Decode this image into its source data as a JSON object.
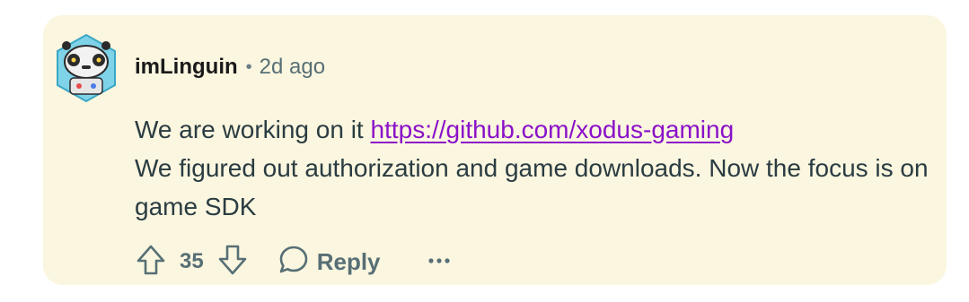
{
  "comment": {
    "author": "imLinguin",
    "separator": "•",
    "time_ago": "2d ago",
    "body": {
      "line1_text": "We are working on it ",
      "link_text": "https://github.com/xodus-gaming",
      "line2_text": "We figured out authorization and game downloads. Now the focus is on game SDK"
    },
    "actions": {
      "score": "35",
      "reply_label": "Reply",
      "more_label": "···"
    }
  },
  "colors": {
    "card_background": "#fbf6df",
    "link": "#8a12c9",
    "muted_text": "#576f76",
    "body_text": "#2a3c42"
  },
  "icons": [
    "avatar",
    "upvote-icon",
    "downvote-icon",
    "reply-bubble-icon",
    "more-options-icon"
  ]
}
